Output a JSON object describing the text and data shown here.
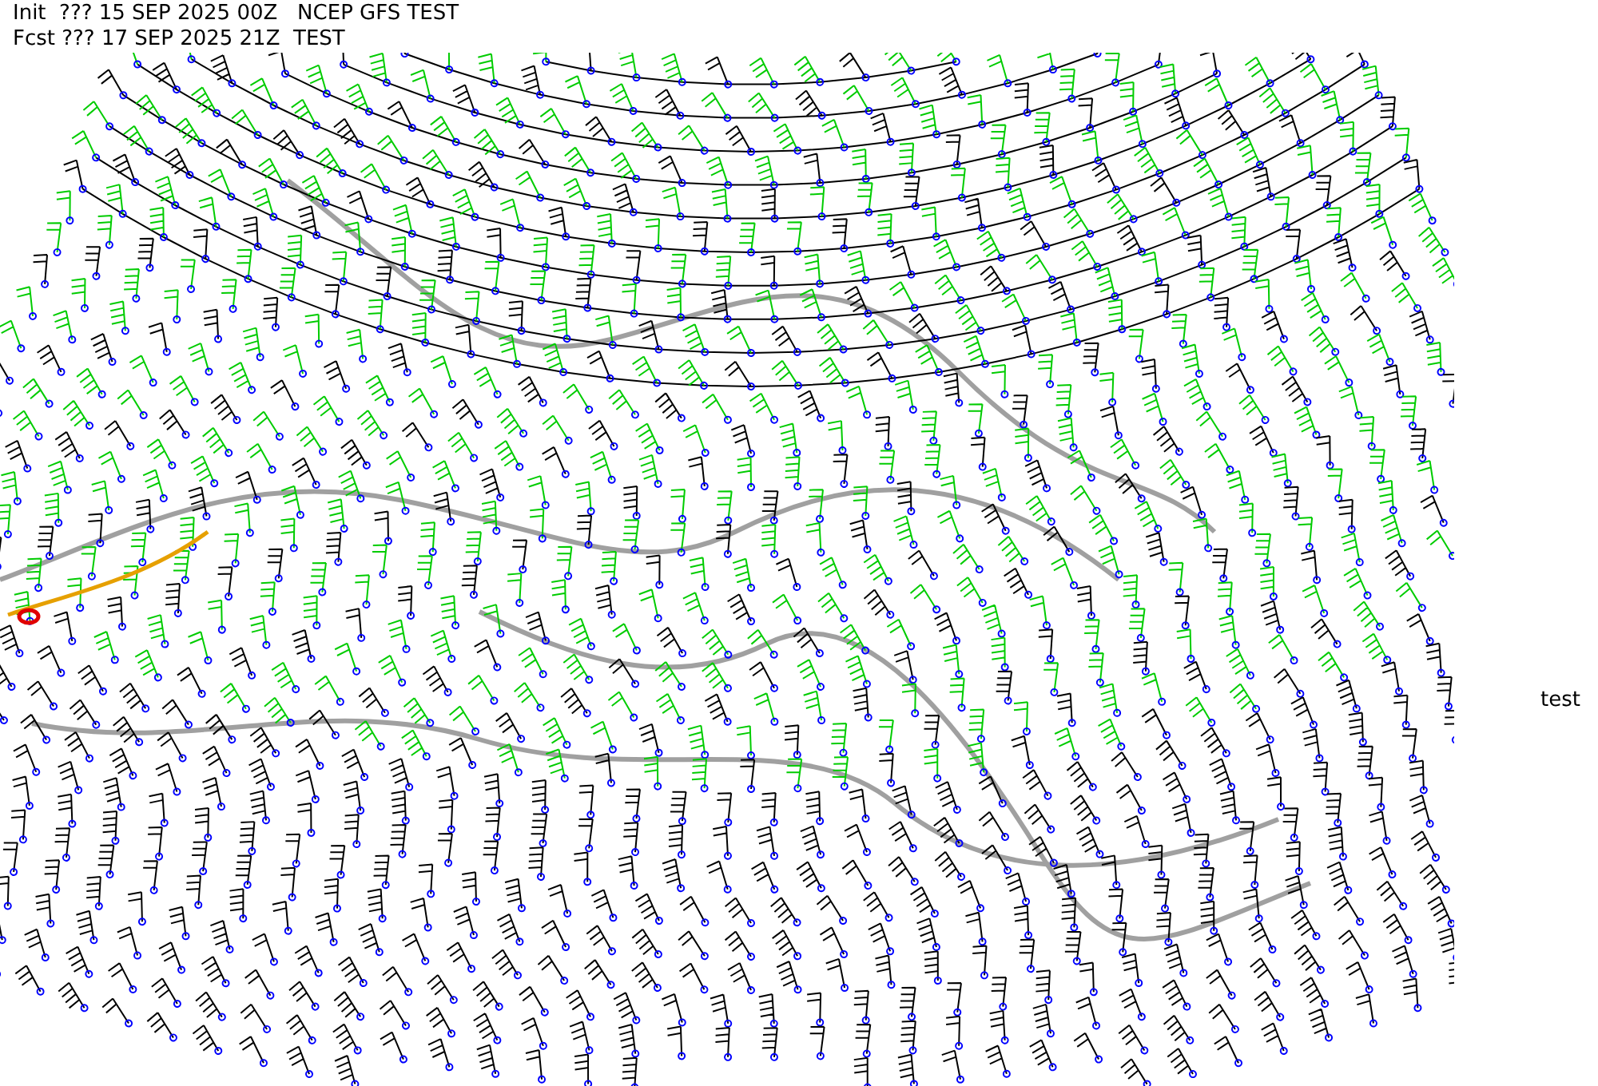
{
  "header": {
    "lines": [
      "Init  ??? 15 SEP 2025 00Z   NCEP GFS TEST",
      "Fcst ??? 17 SEP 2025 21Z  TEST"
    ]
  },
  "side_label": "test"
}
